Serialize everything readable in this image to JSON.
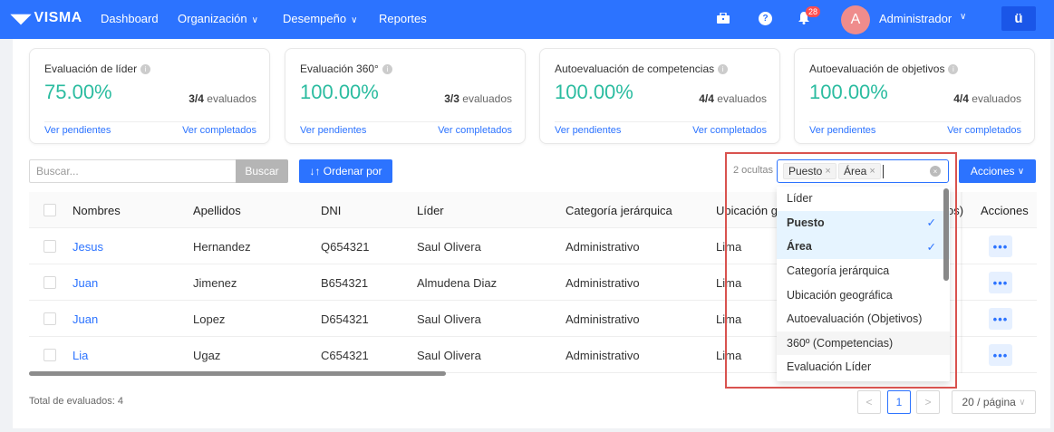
{
  "brand": {
    "name": "VISMA"
  },
  "nav": {
    "dashboard": "Dashboard",
    "organizacion": "Organización",
    "desempeno": "Desempeño",
    "reportes": "Reportes",
    "notification_count": "28",
    "avatar_initial": "A",
    "user_name": "Administrador",
    "app_icon": "ü"
  },
  "cards": [
    {
      "title": "Evaluación de líder",
      "percent": "75.00%",
      "count": "3/4",
      "count_suffix": "evaluados",
      "pending": "Ver pendientes",
      "completed": "Ver completados"
    },
    {
      "title": "Evaluación 360°",
      "percent": "100.00%",
      "count": "3/3",
      "count_suffix": "evaluados",
      "pending": "Ver pendientes",
      "completed": "Ver completados"
    },
    {
      "title": "Autoevaluación de competencias",
      "percent": "100.00%",
      "count": "4/4",
      "count_suffix": "evaluados",
      "pending": "Ver pendientes",
      "completed": "Ver completados"
    },
    {
      "title": "Autoevaluación de objetivos",
      "percent": "100.00%",
      "count": "4/4",
      "count_suffix": "evaluados",
      "pending": "Ver pendientes",
      "completed": "Ver completados"
    }
  ],
  "toolbar": {
    "search_placeholder": "Buscar...",
    "search_button": "Buscar",
    "order_button": "↓↑ Ordenar por",
    "hidden_count": "2 ocultas",
    "actions_button": "Acciones"
  },
  "table": {
    "headers": [
      "Nombres",
      "Apellidos",
      "DNI",
      "Líder",
      "Categoría jerárquica",
      "Ubicación ge",
      "os)",
      "Acciones"
    ],
    "rows": [
      {
        "nombre": "Jesus",
        "apellido": "Hernandez",
        "dni": "Q654321",
        "lider": "Saul Olivera",
        "categoria": "Administrativo",
        "ubicacion": "Lima"
      },
      {
        "nombre": "Juan",
        "apellido": "Jimenez",
        "dni": "B654321",
        "lider": "Almudena Diaz",
        "categoria": "Administrativo",
        "ubicacion": "Lima"
      },
      {
        "nombre": "Juan",
        "apellido": "Lopez",
        "dni": "D654321",
        "lider": "Saul Olivera",
        "categoria": "Administrativo",
        "ubicacion": "Lima"
      },
      {
        "nombre": "Lia",
        "apellido": "Ugaz",
        "dni": "C654321",
        "lider": "Saul Olivera",
        "categoria": "Administrativo",
        "ubicacion": "Lima"
      }
    ],
    "row_action": "•••"
  },
  "column_select": {
    "tags": [
      {
        "label": "Puesto",
        "remove": "×"
      },
      {
        "label": "Área",
        "remove": "×"
      }
    ],
    "clear": "×",
    "options": [
      {
        "label": "Líder",
        "selected": false
      },
      {
        "label": "Puesto",
        "selected": true,
        "check": "✓"
      },
      {
        "label": "Área",
        "selected": true,
        "check": "✓"
      },
      {
        "label": "Categoría jerárquica",
        "selected": false
      },
      {
        "label": "Ubicación geográfica",
        "selected": false
      },
      {
        "label": "Autoevaluación (Objetivos)",
        "selected": false
      },
      {
        "label": "360º (Competencias)",
        "selected": false,
        "hover": true
      },
      {
        "label": "Evaluación Líder",
        "selected": false
      }
    ]
  },
  "footer": {
    "total": "Total de evaluados: 4",
    "prev": "<",
    "page": "1",
    "next": ">",
    "page_size": "20 / página"
  },
  "colors": {
    "primary": "#2c73ff",
    "percent": "#2bbca0",
    "highlight": "#d9534f"
  }
}
